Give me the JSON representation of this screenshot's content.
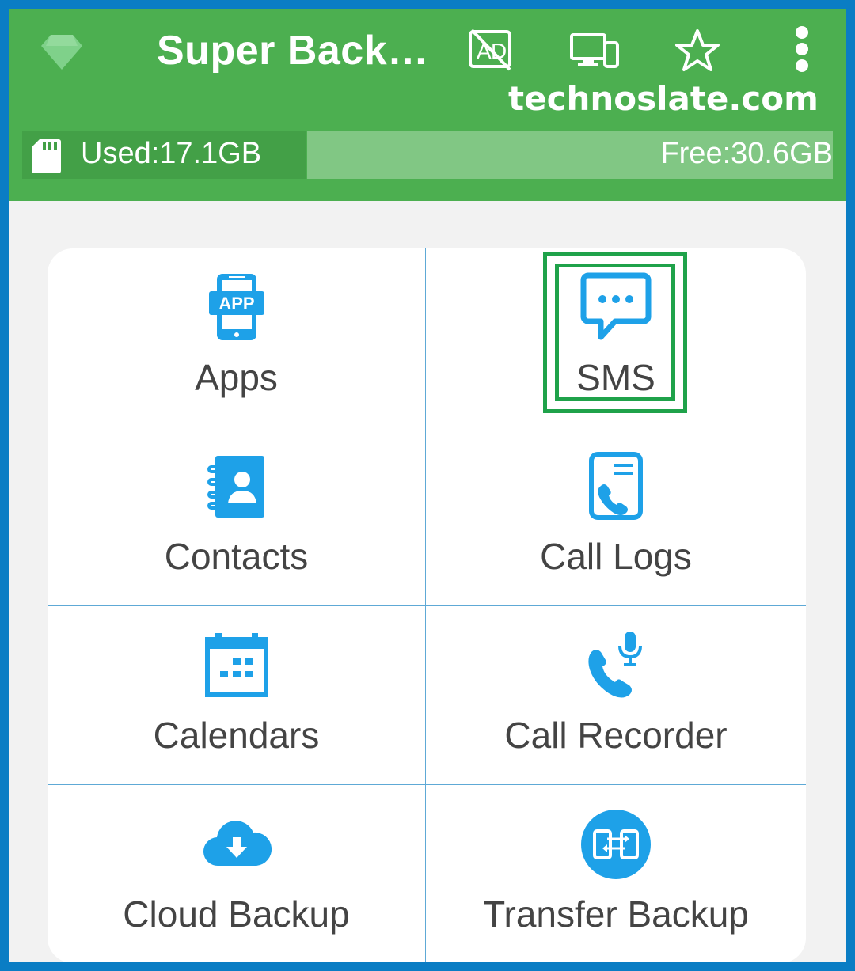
{
  "app": {
    "title": "Super Back…",
    "watermark": "technoslate.com"
  },
  "toolbar": {
    "icons": [
      "diamond-icon",
      "no-ads-icon",
      "devices-icon",
      "star-icon",
      "more-vert-icon"
    ]
  },
  "storage": {
    "used_label": "Used:17.1GB",
    "free_label": "Free:30.6GB"
  },
  "grid": {
    "items": [
      {
        "label": "Apps",
        "icon": "app-icon"
      },
      {
        "label": "SMS",
        "icon": "sms-icon"
      },
      {
        "label": "Contacts",
        "icon": "contacts-icon"
      },
      {
        "label": "Call Logs",
        "icon": "call-logs-icon"
      },
      {
        "label": "Calendars",
        "icon": "calendar-icon"
      },
      {
        "label": "Call Recorder",
        "icon": "call-recorder-icon"
      },
      {
        "label": "Cloud Backup",
        "icon": "cloud-download-icon"
      },
      {
        "label": "Transfer Backup",
        "icon": "transfer-icon"
      }
    ]
  },
  "colors": {
    "appbar": "#4caf50",
    "used_bar": "#43a047",
    "free_bar": "#81c784",
    "icon_blue": "#1ea1e8",
    "highlight": "#1fa24a",
    "frame_border": "#0a7dc4"
  }
}
